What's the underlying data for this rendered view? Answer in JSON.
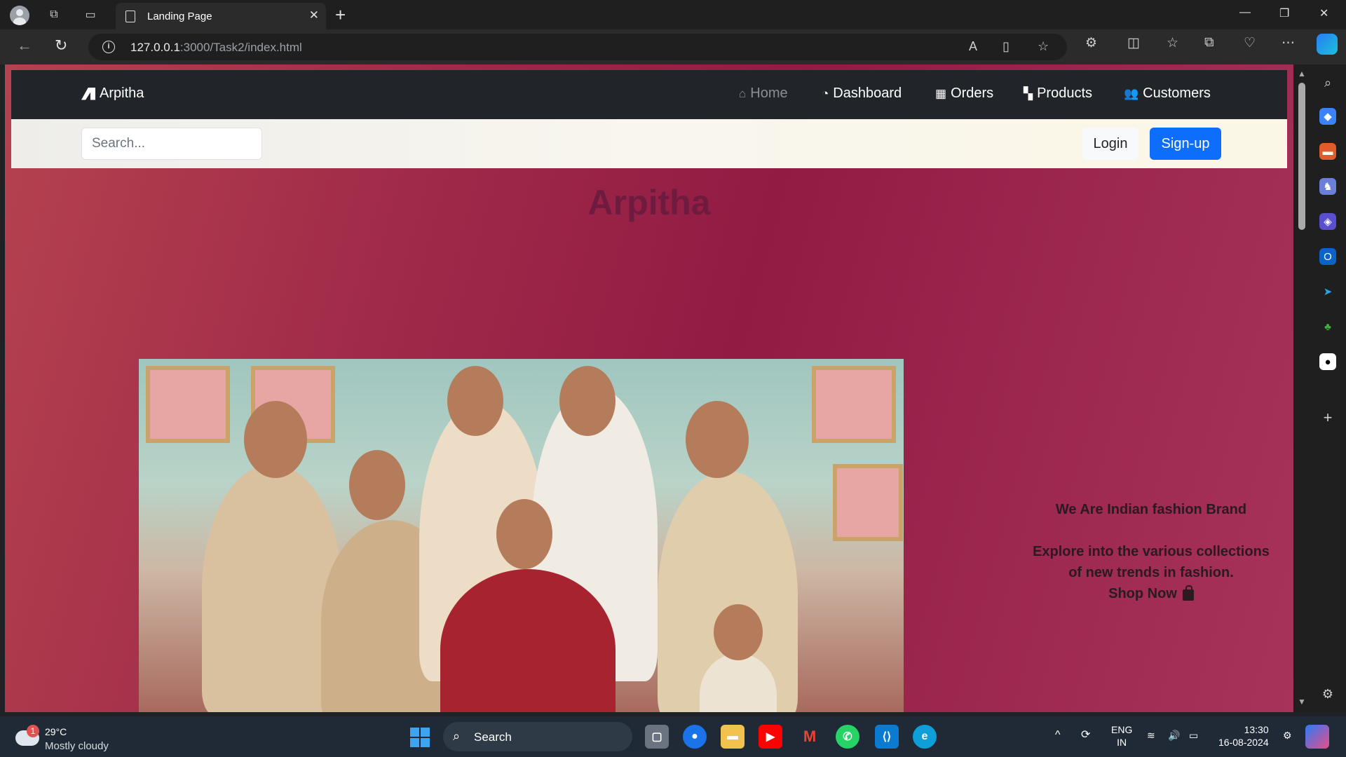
{
  "browser": {
    "tab_title": "Landing Page",
    "url_host": "127.0.0.1",
    "url_path": ":3000/Task2/index.html"
  },
  "site": {
    "brand": "Arpitha",
    "nav": [
      {
        "label": "Home",
        "icon": "home-icon",
        "active": false
      },
      {
        "label": "Dashboard",
        "icon": "speedometer-icon"
      },
      {
        "label": "Orders",
        "icon": "table-icon"
      },
      {
        "label": "Products",
        "icon": "grid-icon"
      },
      {
        "label": "Customers",
        "icon": "people-icon"
      }
    ],
    "search_placeholder": "Search...",
    "login_label": "Login",
    "signup_label": "Sign-up",
    "hero_title": "Arpitha",
    "tagline_1": "We Are Indian fashion Brand",
    "tagline_2": "Explore into the various collections of new trends in fashion.",
    "shop_now": "Shop Now",
    "colors": {
      "navbar": "#212529",
      "signup": "#0d6efd",
      "hero_title": "#6e1b3f",
      "bg_start": "#b5424f",
      "bg_mid": "#921b44"
    }
  },
  "taskbar": {
    "weather_badge": "1",
    "temperature": "29°C",
    "condition": "Mostly cloudy",
    "search_label": "Search",
    "lang_1": "ENG",
    "lang_2": "IN",
    "time": "13:30",
    "date": "16-08-2024"
  }
}
